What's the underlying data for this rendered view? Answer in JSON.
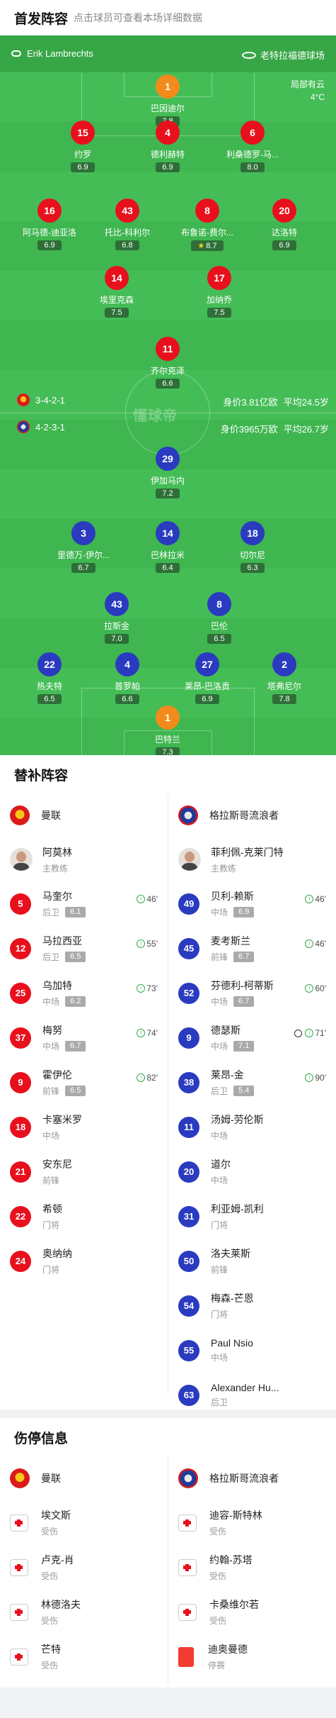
{
  "header": {
    "title": "首发阵容",
    "subtitle": "点击球员可查看本场详细数据"
  },
  "pitch": {
    "home_coach": "Erik Lambrechts",
    "venue": "老特拉福德球场",
    "weather_line1": "局部有云",
    "weather_line2": "4°C",
    "watermark": "懂球帝",
    "home_team": {
      "formation": "3-4-2-1",
      "value": "身价3.81亿欧",
      "age": "平均24.5岁"
    },
    "away_team": {
      "formation": "4-2-3-1",
      "value": "身价3965万欧",
      "age": "平均26.7岁"
    }
  },
  "home_players": [
    {
      "num": "1",
      "name": "巴因迪尔",
      "rating": "7.8",
      "pos": "gk"
    },
    {
      "num": "15",
      "name": "约罗",
      "rating": "6.9",
      "sub": "55'"
    },
    {
      "num": "4",
      "name": "德利赫特",
      "rating": "6.9",
      "sub": "46'"
    },
    {
      "num": "6",
      "name": "利桑德罗-马...",
      "rating": "8.0",
      "ball": true
    },
    {
      "num": "16",
      "name": "阿马德-迪亚洛",
      "rating": "6.9"
    },
    {
      "num": "43",
      "name": "托比-科利尔",
      "rating": "6.8",
      "sub": "73'"
    },
    {
      "num": "8",
      "name": "布鲁诺-费尔...",
      "rating": "8.7",
      "ball": true,
      "captain": true,
      "star": true
    },
    {
      "num": "20",
      "name": "达洛特",
      "rating": "6.9"
    },
    {
      "num": "14",
      "name": "埃里克森",
      "rating": "7.5",
      "sub": "74'"
    },
    {
      "num": "17",
      "name": "加纳乔",
      "rating": "7.5"
    },
    {
      "num": "11",
      "name": "齐尔克泽",
      "rating": "6.6",
      "sub": "82'"
    }
  ],
  "away_players": [
    {
      "num": "29",
      "name": "伊加马内",
      "rating": "7.2"
    },
    {
      "num": "3",
      "name": "里德万-伊尔...",
      "rating": "6.7",
      "sub": "90'"
    },
    {
      "num": "14",
      "name": "巴林拉米",
      "rating": "6.4",
      "sub": "71'"
    },
    {
      "num": "18",
      "name": "切尔尼",
      "rating": "6.3",
      "sub": "60'"
    },
    {
      "num": "43",
      "name": "拉斯金",
      "rating": "7.0"
    },
    {
      "num": "8",
      "name": "巴伦",
      "rating": "6.5",
      "sub": "46'"
    },
    {
      "num": "22",
      "name": "热夫特",
      "rating": "6.5",
      "ycard": true
    },
    {
      "num": "4",
      "name": "普罗帕",
      "rating": "6.6"
    },
    {
      "num": "27",
      "name": "莱昂-巴洛贡",
      "rating": "6.9",
      "sub": "46'"
    },
    {
      "num": "2",
      "name": "塔弗尼尔",
      "rating": "7.8",
      "ball": true,
      "captain": true
    },
    {
      "num": "1",
      "name": "巴特兰",
      "rating": "7.3",
      "pos": "gk",
      "ball": true
    }
  ],
  "subs": {
    "title": "替补阵容",
    "home": {
      "team": "曼联",
      "coach": {
        "name": "阿莫林",
        "role": "主教练"
      },
      "players": [
        {
          "num": "5",
          "name": "马奎尔",
          "pos": "后卫",
          "rating": "6.1",
          "on": "46'"
        },
        {
          "num": "12",
          "name": "马拉西亚",
          "pos": "后卫",
          "rating": "6.5",
          "on": "55'"
        },
        {
          "num": "25",
          "name": "乌加特",
          "pos": "中场",
          "rating": "6.2",
          "on": "73'"
        },
        {
          "num": "37",
          "name": "梅努",
          "pos": "中场",
          "rating": "6.7",
          "on": "74'"
        },
        {
          "num": "9",
          "name": "霍伊伦",
          "pos": "前锋",
          "rating": "6.5",
          "on": "82'"
        },
        {
          "num": "18",
          "name": "卡塞米罗",
          "pos": "中场"
        },
        {
          "num": "21",
          "name": "安东尼",
          "pos": "前锋"
        },
        {
          "num": "22",
          "name": "希顿",
          "pos": "门将"
        },
        {
          "num": "24",
          "name": "奥纳纳",
          "pos": "门将"
        }
      ]
    },
    "away": {
      "team": "格拉斯哥流浪者",
      "coach": {
        "name": "菲利佩-克莱门特",
        "role": "主教练"
      },
      "players": [
        {
          "num": "49",
          "name": "贝利-赖斯",
          "pos": "中场",
          "rating": "6.9",
          "on": "46'"
        },
        {
          "num": "45",
          "name": "麦考斯兰",
          "pos": "前锋",
          "rating": "6.7",
          "on": "46'"
        },
        {
          "num": "52",
          "name": "芬德利-柯蒂斯",
          "pos": "中场",
          "rating": "6.7",
          "on": "60'"
        },
        {
          "num": "9",
          "name": "德瑟斯",
          "pos": "中场",
          "rating": "7.1",
          "on": "71'",
          "goal": true
        },
        {
          "num": "38",
          "name": "莱昂-金",
          "pos": "后卫",
          "rating": "5.4",
          "on": "90'"
        },
        {
          "num": "11",
          "name": "汤姆-劳伦斯",
          "pos": "中场"
        },
        {
          "num": "20",
          "name": "道尔",
          "pos": "中场"
        },
        {
          "num": "31",
          "name": "利亚姆-凯利",
          "pos": "门将"
        },
        {
          "num": "50",
          "name": "洛夫莱斯",
          "pos": "前锋"
        },
        {
          "num": "54",
          "name": "梅森-芒恩",
          "pos": "门将"
        },
        {
          "num": "55",
          "name": "Paul Nsio",
          "pos": "中场"
        },
        {
          "num": "63",
          "name": "Alexander Hu...",
          "pos": "后卫"
        }
      ]
    }
  },
  "injuries": {
    "title": "伤停信息",
    "home": {
      "team": "曼联",
      "players": [
        {
          "name": "埃文斯",
          "status": "受伤"
        },
        {
          "name": "卢克-肖",
          "status": "受伤"
        },
        {
          "name": "林德洛夫",
          "status": "受伤"
        },
        {
          "name": "芒特",
          "status": "受伤"
        }
      ]
    },
    "away": {
      "team": "格拉斯哥流浪者",
      "players": [
        {
          "name": "迪容-斯特林",
          "status": "受伤"
        },
        {
          "name": "约翰-苏塔",
          "status": "受伤"
        },
        {
          "name": "卡桑维尔若",
          "status": "受伤"
        },
        {
          "name": "迪奥曼德",
          "status": "停赛",
          "card": true
        }
      ]
    }
  },
  "colors": {
    "pitch": "#3fb650",
    "home": "#e8101d",
    "away": "#2a3bc0",
    "keeper": "#f28b1b",
    "rating_bg": "#2e6f37"
  }
}
